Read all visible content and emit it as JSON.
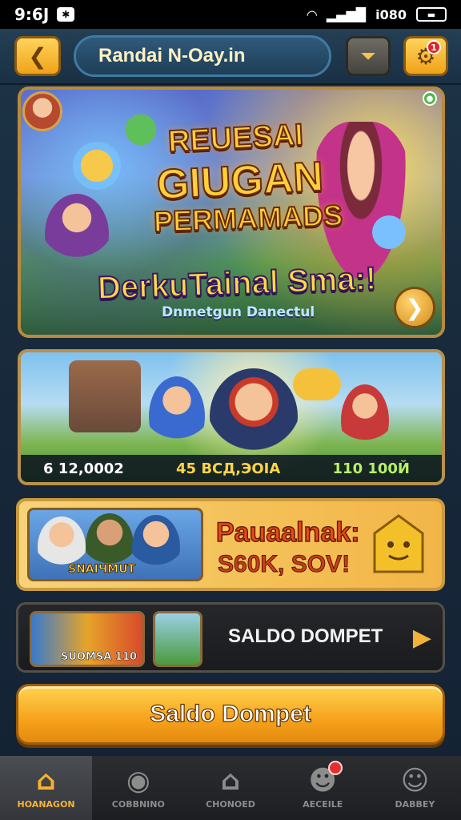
{
  "status_bar": {
    "time": "9:6J",
    "notif_icon": "bluetooth-icon",
    "battery_text": "i080",
    "icons": [
      "wifi-icon",
      "signal-icon",
      "battery-icon"
    ]
  },
  "header": {
    "back_icon": "back-arrow-icon",
    "title": "Randai N-Oay.in",
    "filter_icon": "filter-icon",
    "settings_icon": "gear-icon",
    "settings_badge": "1"
  },
  "hero": {
    "title_line1": "REUESAI",
    "title_line2": "GIUGAN",
    "title_line3": "PERMAMADS",
    "subtitle": "DerkuTainal Sma:!",
    "caption": "Dnmetgun Danectul",
    "next_icon": "chevron-right-icon"
  },
  "banner2": {
    "stat_left": "6 12,0002",
    "stat_mid": "45 ВСД,ЭОIA",
    "stat_right": "110 100Й"
  },
  "promo": {
    "image_label": "SNAIЧMUT",
    "title": "Pauaalnak:",
    "subtitle": "S60K, SOV!"
  },
  "saldo_row": {
    "thumb_label": "SUOMSA 110",
    "text": "SALDO DOMPET",
    "arrow_icon": "chevron-right-icon"
  },
  "main_button": {
    "label": "Saldo Dompet"
  },
  "bottom_nav": {
    "items": [
      {
        "label": "HOANAGON",
        "icon": "home-icon",
        "active": true
      },
      {
        "label": "COBBNINO",
        "icon": "game-icon",
        "active": false
      },
      {
        "label": "CHONOED",
        "icon": "house-icon",
        "active": false
      },
      {
        "label": "AECEILE",
        "icon": "notification-user-icon",
        "active": false
      },
      {
        "label": "DABBEY",
        "icon": "profile-icon",
        "active": false
      }
    ]
  },
  "colors": {
    "accent_gold": "#f6a21c",
    "background": "#1d3548",
    "nav_active": "#f5b43a"
  }
}
